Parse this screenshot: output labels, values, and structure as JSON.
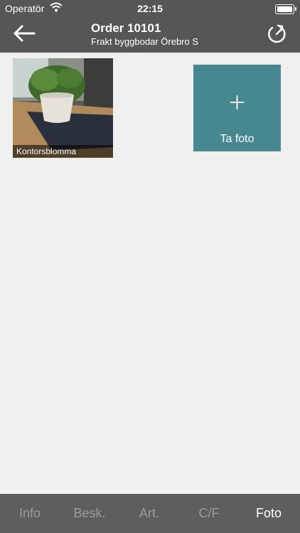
{
  "status_bar": {
    "carrier": "Operatör",
    "time": "22:15",
    "wifi_icon": "wifi-icon",
    "battery_icon": "battery-icon"
  },
  "header": {
    "title": "Order 10101",
    "subtitle": "Frakt byggbodar Örebro S",
    "back_icon": "arrow-left-icon",
    "refresh_icon": "refresh-icon"
  },
  "photos": [
    {
      "caption": "Kontorsblomma"
    }
  ],
  "add_photo": {
    "label": "Ta foto",
    "icon": "plus-icon"
  },
  "tabs": [
    {
      "label": "Info",
      "active": false
    },
    {
      "label": "Besk.",
      "active": false
    },
    {
      "label": "Art.",
      "active": false
    },
    {
      "label": "C/F",
      "active": false
    },
    {
      "label": "Foto",
      "active": true
    }
  ],
  "colors": {
    "header_bg": "#555658",
    "accent": "#478790",
    "tabbar_bg": "#5e5e60",
    "tab_active": "#ffffff",
    "tab_inactive": "#9a9a9c"
  }
}
